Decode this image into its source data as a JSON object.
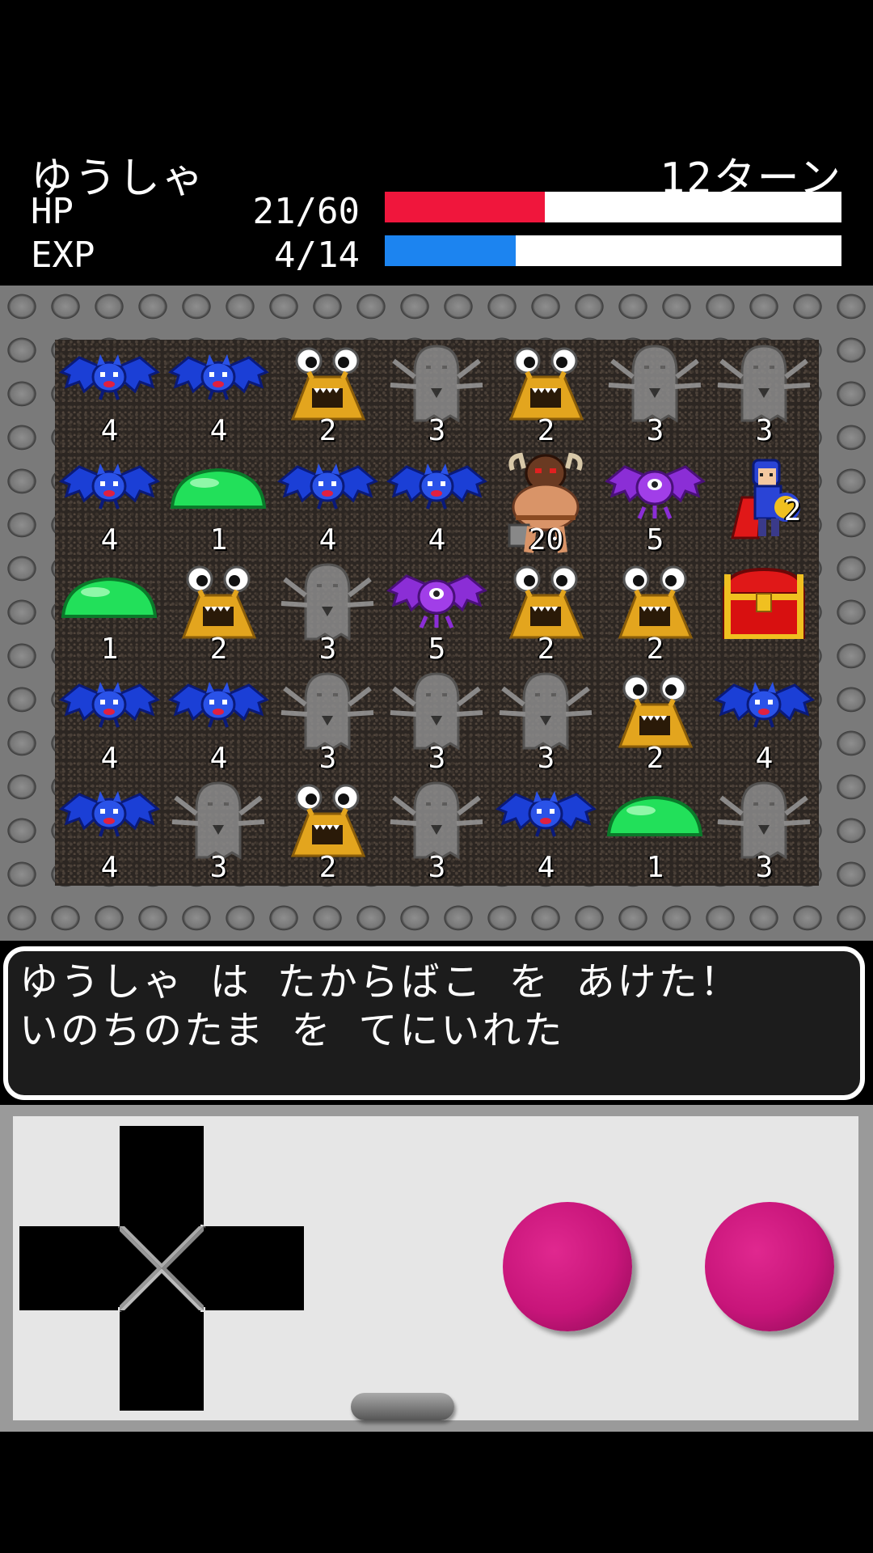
{
  "hud": {
    "hero_name": "ゆうしゃ",
    "turns": "12ターン",
    "hp_label": "HP",
    "hp_value": "21/60",
    "hp_fraction": 0.35,
    "hp_color": "#f0163c",
    "exp_label": "EXP",
    "exp_value": "4/14",
    "exp_fraction": 0.286,
    "exp_color": "#1c84f0"
  },
  "board": {
    "cols": 7,
    "rows": 5,
    "cells": [
      {
        "type": "bat",
        "value": "4"
      },
      {
        "type": "bat",
        "value": "4"
      },
      {
        "type": "eyestalk",
        "value": "2"
      },
      {
        "type": "ghost",
        "value": "3"
      },
      {
        "type": "eyestalk",
        "value": "2"
      },
      {
        "type": "ghost",
        "value": "3"
      },
      {
        "type": "ghost",
        "value": "3"
      },
      {
        "type": "bat",
        "value": "4"
      },
      {
        "type": "slime",
        "value": "1"
      },
      {
        "type": "bat",
        "value": "4"
      },
      {
        "type": "bat",
        "value": "4"
      },
      {
        "type": "minotaur",
        "value": "20"
      },
      {
        "type": "purple-bat",
        "value": "5"
      },
      {
        "type": "hero",
        "value": "2"
      },
      {
        "type": "slime",
        "value": "1"
      },
      {
        "type": "eyestalk",
        "value": "2"
      },
      {
        "type": "ghost",
        "value": "3"
      },
      {
        "type": "purple-bat",
        "value": "5"
      },
      {
        "type": "eyestalk",
        "value": "2"
      },
      {
        "type": "eyestalk",
        "value": "2"
      },
      {
        "type": "treasure",
        "value": ""
      },
      {
        "type": "bat",
        "value": "4"
      },
      {
        "type": "bat",
        "value": "4"
      },
      {
        "type": "ghost",
        "value": "3"
      },
      {
        "type": "ghost",
        "value": "3"
      },
      {
        "type": "ghost",
        "value": "3"
      },
      {
        "type": "eyestalk",
        "value": "2"
      },
      {
        "type": "bat",
        "value": "4"
      },
      {
        "type": "bat",
        "value": "4"
      },
      {
        "type": "ghost",
        "value": "3"
      },
      {
        "type": "eyestalk",
        "value": "2"
      },
      {
        "type": "ghost",
        "value": "3"
      },
      {
        "type": "bat",
        "value": "4"
      },
      {
        "type": "slime",
        "value": "1"
      },
      {
        "type": "ghost",
        "value": "3"
      }
    ]
  },
  "message": {
    "line1": "ゆうしゃ は たからばこ を あけた！",
    "line2": "いのちのたま を てにいれた"
  },
  "controller": {
    "button_color": "#c8157a"
  }
}
